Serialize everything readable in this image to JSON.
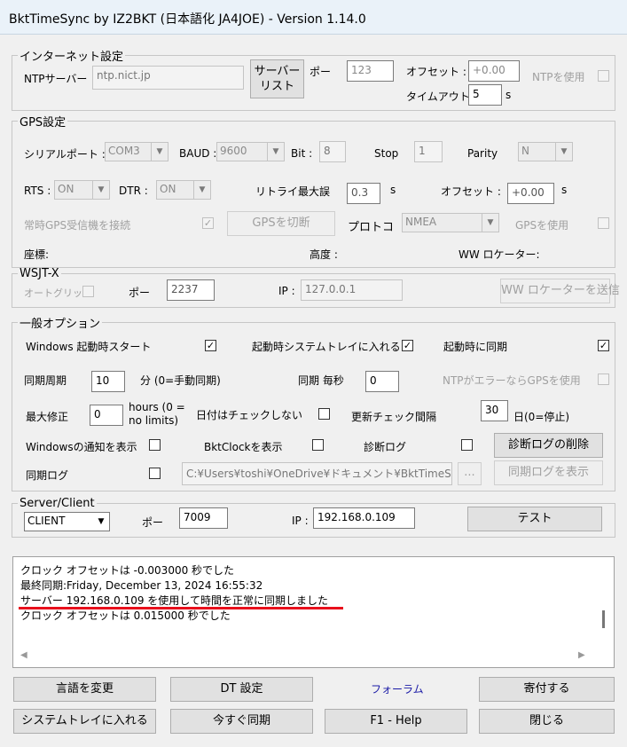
{
  "window": {
    "title": "BktTimeSync by IZ2BKT (日本語化 JA4JOE) - Version 1.14.0"
  },
  "internet": {
    "legend": "インターネット設定",
    "ntp_label": "NTPサーバー",
    "ntp_value": "ntp.nict.jp",
    "server_list_line1": "サーバー",
    "server_list_line2": "リスト",
    "port_label": "ポー",
    "port_value": "123",
    "offset_label": "オフセット :",
    "offset_value": "+0.00",
    "timeout_label": "タイムアウト :",
    "timeout_value": "5",
    "timeout_unit": "s",
    "use_ntp_label": "NTPを使用"
  },
  "gps": {
    "legend": "GPS設定",
    "serial_label": "シリアルポート :",
    "serial_value": "COM3",
    "baud_label": "BAUD :",
    "baud_value": "9600",
    "bit_label": "Bit :",
    "bit_value": "8",
    "stop_label": "Stop",
    "stop_value": "1",
    "parity_label": "Parity",
    "parity_value": "N",
    "rts_label": "RTS :",
    "rts_value": "ON",
    "dtr_label": "DTR :",
    "dtr_value": "ON",
    "retry_label": "リトライ最大誤",
    "retry_value": "0.3",
    "retry_unit": "s",
    "offset_label": "オフセット :",
    "offset_value": "+0.00",
    "offset_unit": "s",
    "always_connect_label": "常時GPS受信機を接続",
    "disconnect_button": "GPSを切断",
    "protocol_label": "プロトコ",
    "protocol_value": "NMEA",
    "use_gps_label": "GPSを使用",
    "coords_label": "座標:",
    "altitude_label": "高度 :",
    "locator_label": "WW ロケーター:"
  },
  "wsjt": {
    "legend": "WSJT-X",
    "auto_grid_label": "オートグリッド",
    "port_label": "ポー",
    "port_value": "2237",
    "ip_label": "IP :",
    "ip_value": "127.0.0.1",
    "send_locator_button": "WW ロケーターを送信"
  },
  "general": {
    "legend": "一般オプション",
    "win_start_label": "Windows 起動時スタート",
    "tray_start_label": "起動時システムトレイに入れる",
    "sync_start_label": "起動時に同期",
    "sync_period_label": "同期周期",
    "sync_period_value": "10",
    "sync_period_unit": "分 (0=手動同期)",
    "sync_every_label": "同期 毎秒",
    "sync_every_value": "0",
    "ntp_error_gps_label": "NTPがエラーならGPSを使用",
    "max_fix_label": "最大修正",
    "max_fix_value": "0",
    "max_fix_unit_line1": "hours (0 =",
    "max_fix_unit_line2": "no limits)",
    "no_date_check_label": "日付はチェックしない",
    "update_interval_label": "更新チェック間隔",
    "update_interval_value": "30",
    "update_interval_unit": "日(0=停止)",
    "win_notify_label": "Windowsの通知を表示",
    "bktclock_label": "BktClockを表示",
    "diag_log_label": "診断ログ",
    "delete_diag_button": "診断ログの削除",
    "sync_log_label": "同期ログ",
    "sync_log_path": "C:¥Users¥toshi¥OneDrive¥ドキュメント¥BktTimeSyn",
    "browse_button": "...",
    "show_sync_log_button": "同期ログを表示"
  },
  "server_client": {
    "legend": "Server/Client",
    "mode_value": "CLIENT",
    "port_label": "ポー",
    "port_value": "7009",
    "ip_label": "IP :",
    "ip_value": "192.168.0.109",
    "test_button": "テスト"
  },
  "log": {
    "lines": [
      "クロック オフセットは -0.003000 秒でした",
      "最終同期:Friday, December 13, 2024 16:55:32",
      "サーバー 192.168.0.109 を使用して時間を正常に同期しました",
      "クロック オフセットは 0.015000 秒でした"
    ],
    "highlight_color": "#e8101c"
  },
  "footer": {
    "change_language": "言語を変更",
    "dt_settings": "DT 設定",
    "forum": "フォーラム",
    "donate": "寄付する",
    "to_tray": "システムトレイに入れる",
    "sync_now": "今すぐ同期",
    "help": "F1 - Help",
    "close": "閉じる"
  },
  "colors": {
    "link": "#1a1aa6",
    "accent": "#0078d7"
  }
}
